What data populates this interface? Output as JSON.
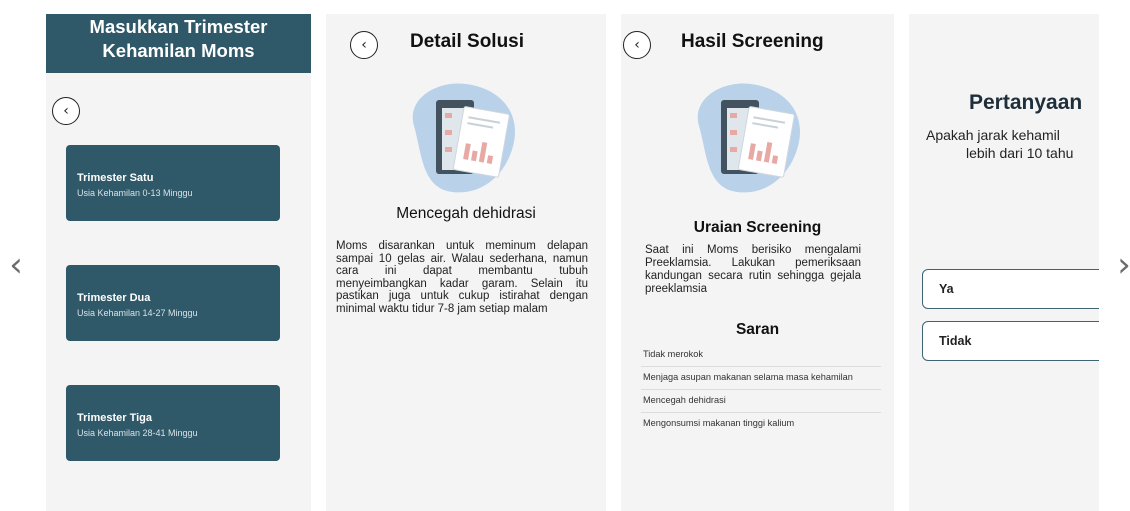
{
  "nav": {
    "prev_symbol": "‹",
    "next_symbol": "›"
  },
  "screen1": {
    "header_line1": "Masukkan Trimester",
    "header_line2": "Kehamilan Moms",
    "back_symbol": "‹",
    "cards": [
      {
        "title": "Trimester Satu",
        "subtitle": "Usia Kehamilan 0-13 Minggu"
      },
      {
        "title": "Trimester Dua",
        "subtitle": "Usia Kehamilan 14-27 Minggu"
      },
      {
        "title": "Trimester Tiga",
        "subtitle": "Usia Kehamilan 28-41 Minggu"
      }
    ],
    "header_color": "#2f5868"
  },
  "screen2": {
    "back_symbol": "‹",
    "title": "Detail Solusi",
    "subtitle": "Mencegah dehidrasi",
    "body": "Moms disarankan untuk meminum delapan sampai 10 gelas air. Walau sederhana, namun cara ini dapat membantu tubuh menyeimbangkan kadar garam. Selain itu pastikan juga untuk cukup istirahat dengan minimal waktu tidur 7-8 jam setiap malam"
  },
  "screen3": {
    "back_symbol": "‹",
    "title": "Hasil Screening",
    "section_title": "Uraian Screening",
    "body": "Saat ini Moms berisiko mengalami Preeklamsia. Lakukan pemeriksaan kandungan secara rutin sehingga gejala preeklamsia",
    "saran_title": "Saran",
    "saran_items": [
      "Tidak merokok",
      "Menjaga asupan makanan selama masa kehamilan",
      "Mencegah dehidrasi",
      "Mengonsumsi makanan tinggi kalium"
    ]
  },
  "screen4": {
    "title": "Pertanyaan",
    "question_line1": "Apakah jarak kehamil",
    "question_line2": "lebih dari 10 tahu",
    "options": [
      "Ya",
      "Tidak"
    ],
    "accent_color": "#3e6474"
  }
}
